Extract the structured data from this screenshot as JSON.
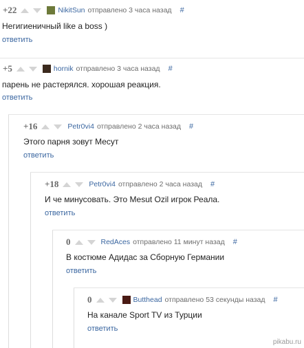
{
  "comments": [
    {
      "rating": "+22",
      "author": "NikitSun",
      "time": "отправлено 3 часа назад",
      "hash": "#",
      "text": "Негигиеничный like a boss )",
      "reply": "ответить",
      "avatar_icon": "nikitsun-avatar-icon",
      "avatar_color": "#6d7a3a"
    },
    {
      "rating": "+5",
      "author": "hornik",
      "time": "отправлено 3 часа назад",
      "hash": "#",
      "text": "парень не растерялся. хорошая реакция.",
      "reply": "ответить",
      "avatar_icon": "hornik-avatar-icon",
      "avatar_color": "#3b2a1e"
    },
    {
      "rating": "+16",
      "author": "Petr0vi4",
      "time": "отправлено 2 часа назад",
      "hash": "#",
      "text": "Этого парня зовут Месут",
      "reply": "ответить"
    },
    {
      "rating": "+18",
      "author": "Petr0vi4",
      "time": "отправлено 2 часа назад",
      "hash": "#",
      "text": "И че минусовать. Это Mesut Ozil игрок Реала.",
      "reply": "ответить"
    },
    {
      "rating": "0",
      "author": "RedAces",
      "time": "отправлено 11 минут назад",
      "hash": "#",
      "text": "В костюме Адидас за Сборную Германии",
      "reply": "ответить"
    },
    {
      "rating": "0",
      "author": "Butthead",
      "time": "отправлено 53 секунды назад",
      "hash": "#",
      "text": "На канале Sport TV из Турции",
      "reply": "ответить",
      "avatar_icon": "butthead-avatar-icon",
      "avatar_color": "#4a1a14"
    }
  ],
  "watermark": "pikabu.ru",
  "colors": {
    "link": "#3a66a0",
    "arrow": "#d4d4d4",
    "rating": "#6a6a6a"
  }
}
